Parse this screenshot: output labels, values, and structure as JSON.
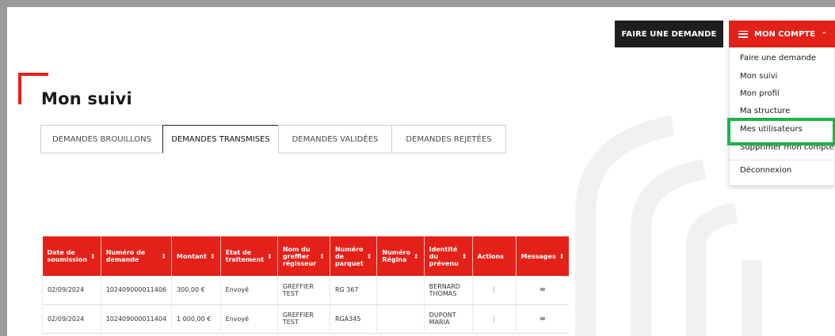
{
  "header": {
    "request_button": "FAIRE UNE DEMANDE",
    "account_button": "MON COMPTE",
    "account_chevron": "^"
  },
  "account_menu": {
    "items": [
      "Faire une demande",
      "Mon suivi",
      "Mon profil",
      "Ma structure",
      "Mes utilisateurs",
      "Supprimer mon compte",
      "Déconnexion"
    ],
    "highlighted_item": "Mes utilisateurs",
    "highlight_color": "#1cb34a"
  },
  "page": {
    "title": "Mon suivi",
    "accent_color": "#e32119"
  },
  "tabs": [
    {
      "label": "DEMANDES BROUILLONS",
      "active": false
    },
    {
      "label": "DEMANDES TRANSMISES",
      "active": true
    },
    {
      "label": "DEMANDES VALIDÉES",
      "active": false
    },
    {
      "label": "DEMANDES REJETÉES",
      "active": false
    }
  ],
  "table": {
    "columns": [
      "Date de soumission",
      "Numéro de demande",
      "Montant",
      "Etat de traitement",
      "Nom du greffier régisseur",
      "Numéro de parquet",
      "Numéro Régina",
      "Identité du prévenu",
      "Actions",
      "Messages"
    ],
    "rows": [
      [
        "02/09/2024",
        "102409000011406",
        "300,00 €",
        "Envoyé",
        "GREFFIER TEST",
        "RG 367",
        "",
        "BERNARD THOMAS",
        "⋮",
        "✉"
      ],
      [
        "02/09/2024",
        "102409000011404",
        "1 000,00 €",
        "Envoyé",
        "GREFFIER TEST",
        "RGA345",
        "",
        "DUPONT MARIA",
        "⋮",
        "✉"
      ]
    ],
    "header_color": "#e32119"
  },
  "icons": {
    "menu": "hamburger-icon",
    "chevron": "chevron-up-icon",
    "sort": "sort-icon",
    "actions": "more-vertical-icon",
    "messages": "envelope-icon"
  }
}
